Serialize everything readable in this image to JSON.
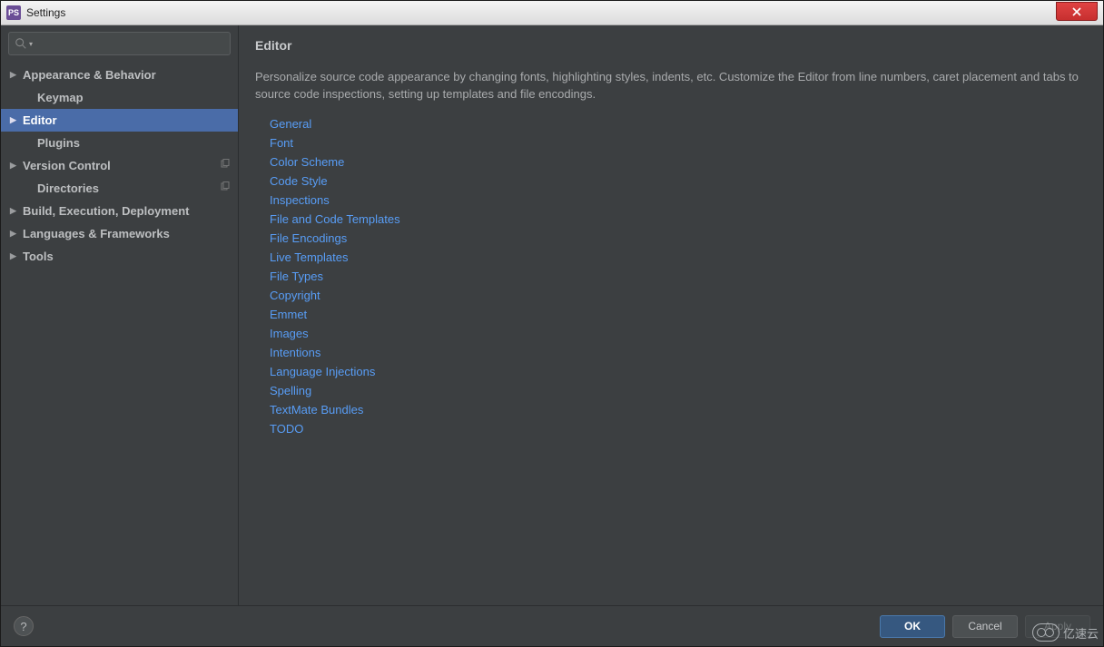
{
  "window": {
    "title": "Settings"
  },
  "search": {
    "placeholder": ""
  },
  "sidebar": {
    "items": [
      {
        "label": "Appearance & Behavior",
        "expandable": true,
        "child": false,
        "selected": false,
        "copy": false
      },
      {
        "label": "Keymap",
        "expandable": false,
        "child": true,
        "selected": false,
        "copy": false
      },
      {
        "label": "Editor",
        "expandable": true,
        "child": false,
        "selected": true,
        "copy": false
      },
      {
        "label": "Plugins",
        "expandable": false,
        "child": true,
        "selected": false,
        "copy": false
      },
      {
        "label": "Version Control",
        "expandable": true,
        "child": false,
        "selected": false,
        "copy": true
      },
      {
        "label": "Directories",
        "expandable": false,
        "child": true,
        "selected": false,
        "copy": true
      },
      {
        "label": "Build, Execution, Deployment",
        "expandable": true,
        "child": false,
        "selected": false,
        "copy": false
      },
      {
        "label": "Languages & Frameworks",
        "expandable": true,
        "child": false,
        "selected": false,
        "copy": false
      },
      {
        "label": "Tools",
        "expandable": true,
        "child": false,
        "selected": false,
        "copy": false
      }
    ]
  },
  "content": {
    "heading": "Editor",
    "description": "Personalize source code appearance by changing fonts, highlighting styles, indents, etc. Customize the Editor from line numbers, caret placement and tabs to source code inspections, setting up templates and file encodings.",
    "links": [
      "General",
      "Font",
      "Color Scheme",
      "Code Style",
      "Inspections",
      "File and Code Templates",
      "File Encodings",
      "Live Templates",
      "File Types",
      "Copyright",
      "Emmet",
      "Images",
      "Intentions",
      "Language Injections",
      "Spelling",
      "TextMate Bundles",
      "TODO"
    ]
  },
  "footer": {
    "help": "?",
    "ok": "OK",
    "cancel": "Cancel",
    "apply": "Apply"
  },
  "watermark": "亿速云"
}
